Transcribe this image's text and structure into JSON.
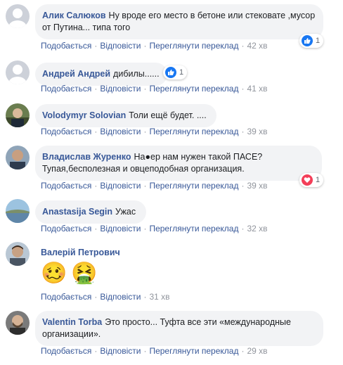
{
  "actions": {
    "like": "Подобається",
    "reply": "Відповісти",
    "translate": "Переглянути переклад"
  },
  "colors": {
    "link": "#385898",
    "bubble": "#f2f3f5",
    "meta": "#90949c",
    "like_blue": "#1877f2",
    "love_red": "#f33e58"
  },
  "comments": [
    {
      "author": "Алик Салюков",
      "text": "Ну вроде его место в бетоне или стековате ,мусор от Путина... типа того",
      "time": "42 хв",
      "reaction": {
        "icon": "like-icon",
        "count": "1"
      }
    },
    {
      "author": "Андрей Андрей",
      "text": "дибилы......",
      "time": "41 хв",
      "reaction": {
        "icon": "like-icon",
        "count": "1"
      }
    },
    {
      "author": "Volodymyr Solovian",
      "text": "Толи ещё будет. ....",
      "time": "39 хв"
    },
    {
      "author": "Владислав Журенко",
      "text": "На●ер нам нужен такой ПАСЕ? Тупая,бесполезная и овцеподобная организация.",
      "time": "39 хв",
      "reaction": {
        "icon": "love-icon",
        "count": "1"
      }
    },
    {
      "author": "Anastasija Segin",
      "text": "Ужас",
      "time": "32 хв"
    },
    {
      "author": "Валерій Петрович",
      "emojis": [
        "🥴",
        "🤮"
      ],
      "time": "31 хв"
    },
    {
      "author": "Valentin Torba",
      "text": "Это просто... Туфта все эти «международные организации».",
      "time": "29 хв"
    }
  ]
}
